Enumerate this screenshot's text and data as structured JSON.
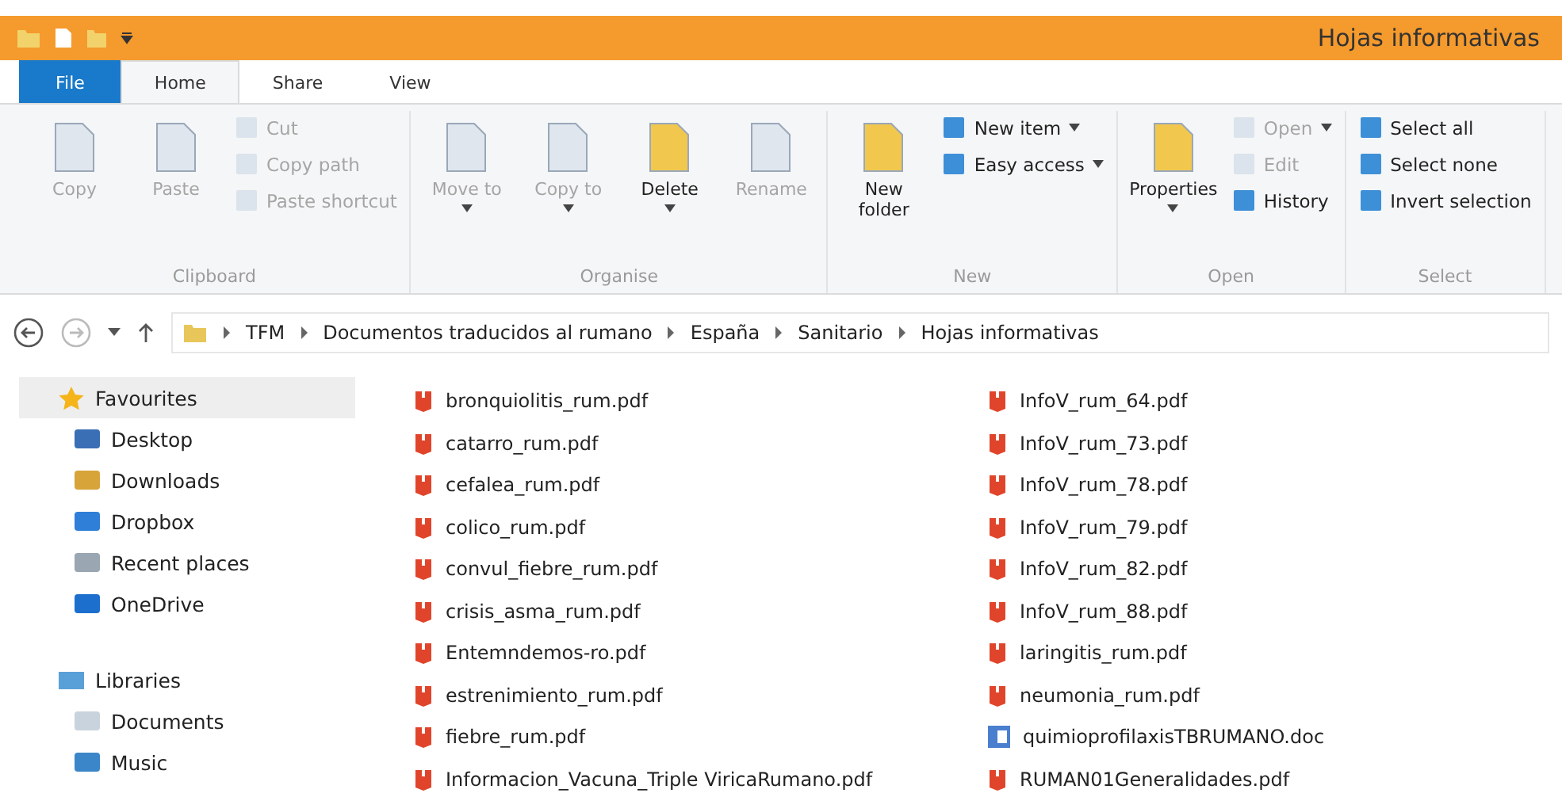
{
  "window": {
    "title": "Hojas informativas"
  },
  "tabs": [
    {
      "label": "File",
      "kind": "file",
      "selected": false
    },
    {
      "label": "Home",
      "kind": "tab",
      "selected": true
    },
    {
      "label": "Share",
      "kind": "tab",
      "selected": false
    },
    {
      "label": "View",
      "kind": "tab",
      "selected": false
    }
  ],
  "ribbon": [
    {
      "label": "Clipboard",
      "items": [
        {
          "label": "Copy",
          "kind": "large",
          "disabled": true,
          "dropdown": false
        },
        {
          "label": "Paste",
          "kind": "large",
          "disabled": true,
          "dropdown": false
        },
        {
          "kind": "stack",
          "items": [
            {
              "label": "Cut",
              "disabled": true,
              "dropdown": false
            },
            {
              "label": "Copy path",
              "disabled": true,
              "dropdown": false
            },
            {
              "label": "Paste shortcut",
              "disabled": true,
              "dropdown": false
            }
          ]
        }
      ]
    },
    {
      "label": "Organise",
      "items": [
        {
          "label": "Move to",
          "kind": "large",
          "disabled": true,
          "dropdown": true
        },
        {
          "label": "Copy to",
          "kind": "large",
          "disabled": true,
          "dropdown": true
        },
        {
          "label": "Delete",
          "kind": "large",
          "disabled": false,
          "dropdown": true
        },
        {
          "label": "Rename",
          "kind": "large",
          "disabled": true,
          "dropdown": false
        }
      ]
    },
    {
      "label": "New",
      "items": [
        {
          "label": "New folder",
          "kind": "large",
          "disabled": false,
          "dropdown": false
        },
        {
          "kind": "stack",
          "items": [
            {
              "label": "New item",
              "disabled": false,
              "dropdown": true
            },
            {
              "label": "Easy access",
              "disabled": false,
              "dropdown": true
            }
          ]
        }
      ]
    },
    {
      "label": "Open",
      "items": [
        {
          "label": "Properties",
          "kind": "large",
          "disabled": false,
          "dropdown": true
        },
        {
          "kind": "stack",
          "items": [
            {
              "label": "Open",
              "disabled": true,
              "dropdown": true
            },
            {
              "label": "Edit",
              "disabled": true,
              "dropdown": false
            },
            {
              "label": "History",
              "disabled": false,
              "dropdown": false
            }
          ]
        }
      ]
    },
    {
      "label": "Select",
      "items": [
        {
          "kind": "stack",
          "items": [
            {
              "label": "Select all",
              "disabled": false,
              "dropdown": false
            },
            {
              "label": "Select none",
              "disabled": false,
              "dropdown": false
            },
            {
              "label": "Invert selection",
              "disabled": false,
              "dropdown": false
            }
          ]
        }
      ]
    }
  ],
  "breadcrumb": [
    "TFM",
    "Documentos traducidos al rumano",
    "España",
    "Sanitario",
    "Hojas informativas"
  ],
  "sidebar": [
    {
      "label": "Favourites",
      "selected": true,
      "children": [
        {
          "label": "Desktop",
          "selected": false
        },
        {
          "label": "Downloads",
          "selected": false
        },
        {
          "label": "Dropbox",
          "selected": false
        },
        {
          "label": "Recent places",
          "selected": false
        },
        {
          "label": "OneDrive",
          "selected": false
        }
      ]
    },
    {
      "label": "Libraries",
      "selected": false,
      "children": [
        {
          "label": "Documents",
          "selected": false
        },
        {
          "label": "Music",
          "selected": false
        }
      ]
    }
  ],
  "files": [
    {
      "name": "bronquiolitis_rum.pdf",
      "kind": "pdf"
    },
    {
      "name": "catarro_rum.pdf",
      "kind": "pdf"
    },
    {
      "name": "cefalea_rum.pdf",
      "kind": "pdf"
    },
    {
      "name": "colico_rum.pdf",
      "kind": "pdf"
    },
    {
      "name": "convul_fiebre_rum.pdf",
      "kind": "pdf"
    },
    {
      "name": "crisis_asma_rum.pdf",
      "kind": "pdf"
    },
    {
      "name": "Entemndemos-ro.pdf",
      "kind": "pdf"
    },
    {
      "name": "estrenimiento_rum.pdf",
      "kind": "pdf"
    },
    {
      "name": "fiebre_rum.pdf",
      "kind": "pdf"
    },
    {
      "name": "Informacion_Vacuna_Triple ViricaRumano.pdf",
      "kind": "pdf"
    },
    {
      "name": "InfoV_rum_64.pdf",
      "kind": "pdf"
    },
    {
      "name": "InfoV_rum_73.pdf",
      "kind": "pdf"
    },
    {
      "name": "InfoV_rum_78.pdf",
      "kind": "pdf"
    },
    {
      "name": "InfoV_rum_79.pdf",
      "kind": "pdf"
    },
    {
      "name": "InfoV_rum_82.pdf",
      "kind": "pdf"
    },
    {
      "name": "InfoV_rum_88.pdf",
      "kind": "pdf"
    },
    {
      "name": "laringitis_rum.pdf",
      "kind": "pdf"
    },
    {
      "name": "neumonia_rum.pdf",
      "kind": "pdf"
    },
    {
      "name": "quimioprofilaxisTBRUMANO.doc",
      "kind": "doc"
    },
    {
      "name": "RUMAN01Generalidades.pdf",
      "kind": "pdf"
    }
  ]
}
